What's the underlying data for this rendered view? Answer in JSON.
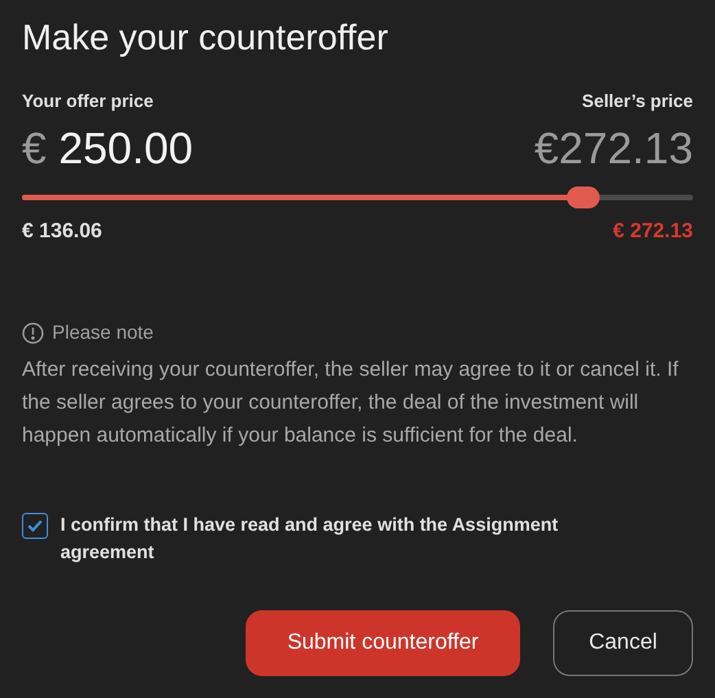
{
  "title": "Make your counteroffer",
  "offer": {
    "label": "Your offer price",
    "currency": "€",
    "amount": "250.00"
  },
  "seller": {
    "label": "Seller’s price",
    "price": "€272.13"
  },
  "slider": {
    "level": 0.837,
    "min_label": "€ 136.06",
    "max_label": "€ 272.13"
  },
  "note": {
    "title": "Please note",
    "text": "After receiving your counteroffer, the seller may agree to it or cancel it. If the seller agrees to your counteroffer, the deal of the investment will happen automatically if your balance is sufficient for the deal."
  },
  "confirm": {
    "label": "I confirm that I have read and agree with the Assignment agreement",
    "checked": true
  },
  "buttons": [
    {
      "label": "Submit counteroffer",
      "kind": "primary"
    },
    {
      "label": "Cancel",
      "kind": "secondary"
    }
  ]
}
